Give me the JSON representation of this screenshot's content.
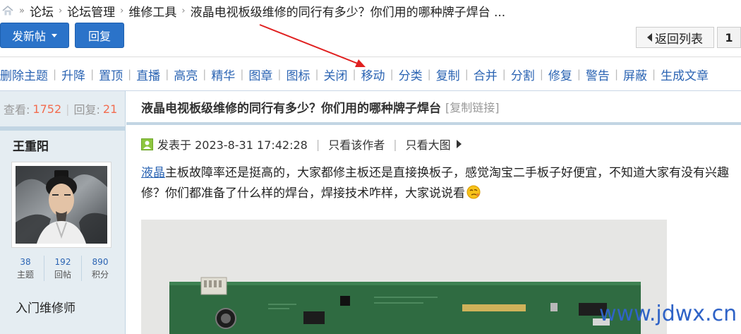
{
  "breadcrumb": {
    "items": [
      "论坛",
      "论坛管理",
      "维修工具"
    ],
    "current": "液晶电视板级维修的同行有多少？你们用的哪种牌子焊台 ..."
  },
  "toolbar": {
    "post_label": "发新帖",
    "reply_label": "回复",
    "back_label": "返回列表",
    "page_number": "1"
  },
  "mod_tools": [
    "删除主题",
    "升降",
    "置顶",
    "直播",
    "高亮",
    "精华",
    "图章",
    "图标",
    "关闭",
    "移动",
    "分类",
    "复制",
    "合并",
    "分割",
    "修复",
    "警告",
    "屏蔽",
    "生成文章"
  ],
  "stats": {
    "views_label": "查看:",
    "views": "1752",
    "replies_label": "回复:",
    "replies": "21"
  },
  "thread": {
    "title": "液晶电视板级维修的同行有多少？你们用的哪种牌子焊台",
    "copy_link": "[复制链接]"
  },
  "author": {
    "name": "王重阳",
    "stats": [
      {
        "value": "38",
        "label": "主题"
      },
      {
        "value": "192",
        "label": "回帖"
      },
      {
        "value": "890",
        "label": "积分"
      }
    ],
    "rank": "入门维修师"
  },
  "post": {
    "posted_at": "发表于 2023-8-31 17:42:28",
    "only_author": "只看该作者",
    "big_image": "只看大图",
    "keyword": "液晶",
    "body": "主板故障率还是挺高的，大家都修主板还是直接换板子，感觉淘宝二手板子好便宜，不知道大家有没有兴趣修？你们都准备了什么样的焊台，焊接技术咋样，大家说说看"
  },
  "watermark": "www.jdwx.cn",
  "colors": {
    "accent_blue": "#2b73c9",
    "link_blue": "#2b64b3",
    "stat_orange": "#f26c4f",
    "sidebar_bg": "#e5edf2",
    "annotation_red": "#e02020"
  },
  "icons": [
    "home-icon",
    "online-status-icon",
    "emoji-icon",
    "moon-icon"
  ]
}
